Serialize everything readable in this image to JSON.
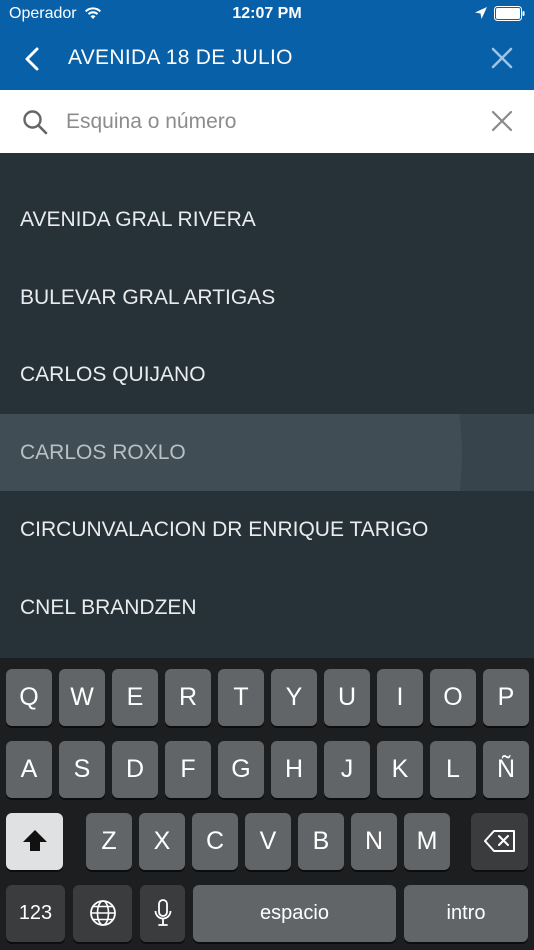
{
  "status_bar": {
    "carrier": "Operador",
    "time": "12:07 PM"
  },
  "header": {
    "title": "AVENIDA 18 DE JULIO"
  },
  "search": {
    "placeholder": "Esquina o número",
    "value": ""
  },
  "results": [
    {
      "label": "AVENIDA GRAL RIVERA"
    },
    {
      "label": "BULEVAR GRAL ARTIGAS"
    },
    {
      "label": "CARLOS QUIJANO"
    },
    {
      "label": "CARLOS ROXLO",
      "highlighted": true
    },
    {
      "label": "CIRCUNVALACION DR ENRIQUE TARIGO"
    },
    {
      "label": "CNEL BRANDZEN"
    }
  ],
  "keyboard": {
    "row1": [
      "Q",
      "W",
      "E",
      "R",
      "T",
      "Y",
      "U",
      "I",
      "O",
      "P"
    ],
    "row2": [
      "A",
      "S",
      "D",
      "F",
      "G",
      "H",
      "J",
      "K",
      "L",
      "Ñ"
    ],
    "row3": [
      "Z",
      "X",
      "C",
      "V",
      "B",
      "N",
      "M"
    ],
    "numbers_label": "123",
    "space_label": "espacio",
    "return_label": "intro"
  },
  "colors": {
    "app_bar": "#0760a8",
    "list_bg": "#263238",
    "keyboard_bg": "#1c1e20"
  }
}
